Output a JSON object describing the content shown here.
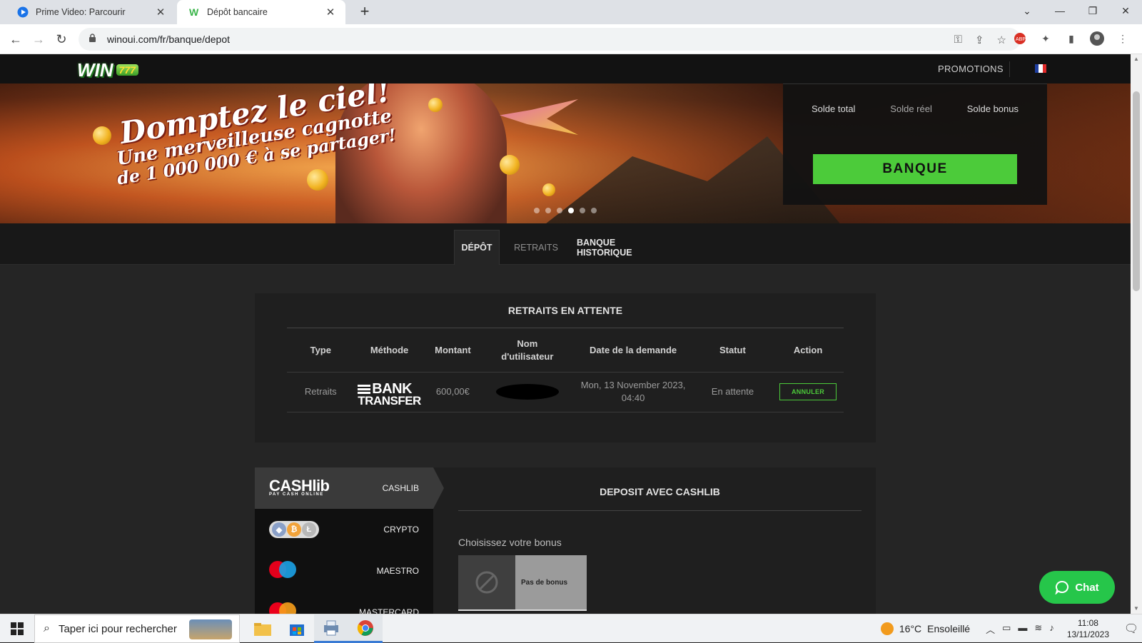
{
  "browser": {
    "tabs": [
      {
        "title": "Prime Video: Parcourir",
        "favicon": "prime-video-icon",
        "active": false
      },
      {
        "title": "Dépôt bancaire",
        "favicon": "winoui-icon",
        "active": true
      }
    ],
    "url": "winoui.com/fr/banque/depot"
  },
  "site": {
    "logo_text": "WIN",
    "logo_badge": "777",
    "nav_promotions": "PROMOTIONS",
    "language": "fr",
    "brand_green": "#4ccb3a"
  },
  "banner": {
    "slogan_line1": "Domptez le ciel!",
    "slogan_line2": "Une merveilleuse cagnotte",
    "slogan_line3": "de 1 000 000 € à se partager!",
    "slide_count": 6,
    "active_slide": 4
  },
  "balance": {
    "total_label": "Solde total",
    "real_label": "Solde réel",
    "bonus_label": "Solde bonus",
    "bank_button": "BANQUE"
  },
  "bank_tabs": [
    {
      "label": "DÉPÔT",
      "active": true
    },
    {
      "label": "RETRAITS",
      "active": false
    },
    {
      "label": "BANQUE HISTORIQUE",
      "active": false
    }
  ],
  "pending": {
    "title": "RETRAITS EN ATTENTE",
    "columns": [
      "Type",
      "Méthode",
      "Montant",
      "Nom d'utilisateur",
      "Date de la demande",
      "Statut",
      "Action"
    ],
    "rows": [
      {
        "type": "Retraits",
        "method_logo_l1": "BANK",
        "method_logo_l2": "TRANSFER",
        "amount": "600,00€",
        "username": "",
        "date": "Mon, 13 November 2023, 04:40",
        "status": "En attente",
        "status_color": "#e27a1b",
        "action": "ANNULER"
      }
    ]
  },
  "deposit": {
    "methods": [
      {
        "label": "CASHLIB",
        "logo": "CASHlib",
        "logo_sub": "PAY CASH ONLINE",
        "active": true
      },
      {
        "label": "CRYPTO",
        "logo": "crypto-coins-icon",
        "active": false
      },
      {
        "label": "MAESTRO",
        "logo": "maestro-icon",
        "logo_sub": "maestro",
        "active": false
      },
      {
        "label": "MASTERCARD",
        "logo": "mastercard-icon",
        "active": false
      }
    ],
    "title": "DEPOSIT AVEC CASHLIB",
    "bonus_label": "Choisissez votre bonus",
    "bonus_option": "Pas de bonus"
  },
  "chat": {
    "label": "Chat"
  },
  "taskbar": {
    "search_placeholder": "Taper ici pour rechercher",
    "weather_temp": "16°C",
    "weather_desc": "Ensoleillé",
    "time": "11:08",
    "date": "13/11/2023"
  }
}
